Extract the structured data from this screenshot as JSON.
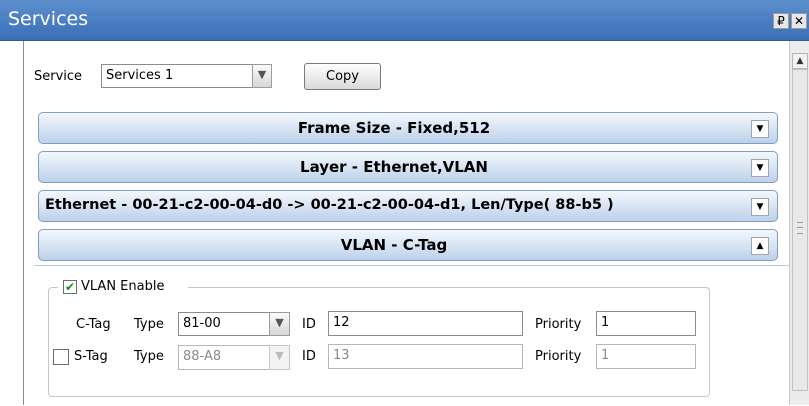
{
  "window": {
    "title": "Services",
    "pin_glyph": "₽",
    "close_glyph": "✕"
  },
  "service_row": {
    "label": "Service",
    "value": "Services 1",
    "copy_label": "Copy"
  },
  "sections": [
    {
      "title": "Frame Size - Fixed,512",
      "expanded": false
    },
    {
      "title": "Layer - Ethernet,VLAN",
      "expanded": false
    },
    {
      "title": "Ethernet - 00-21-c2-00-04-d0 -> 00-21-c2-00-04-d1, Len/Type( 88-b5 )",
      "expanded": false
    },
    {
      "title": "VLAN - C-Tag",
      "expanded": true
    }
  ],
  "arrows": {
    "down": "▼",
    "up": "▲"
  },
  "vlan": {
    "enable_label": "VLAN Enable",
    "enable_checked": true,
    "check_glyph": "✔",
    "ctag": {
      "label": "C-Tag",
      "type_label": "Type",
      "type_value": "81-00",
      "id_label": "ID",
      "id_value": "12",
      "priority_label": "Priority",
      "priority_value": "1"
    },
    "stag": {
      "label": "S-Tag",
      "checked": false,
      "type_label": "Type",
      "type_value": "88-A8",
      "id_label": "ID",
      "id_value": "13",
      "priority_label": "Priority",
      "priority_value": "1"
    }
  },
  "colors": {
    "titlebar": "#3a6fb8",
    "section_header": "#bcd1ea",
    "check_green": "#1a8a1a"
  }
}
